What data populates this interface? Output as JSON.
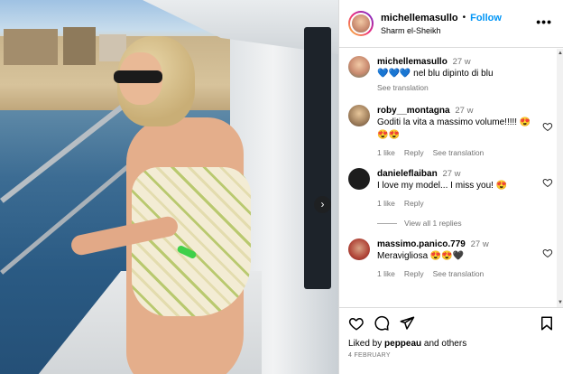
{
  "post": {
    "author": "michellemasullo",
    "follow_label": "Follow",
    "location": "Sharm el-Sheikh",
    "more_label": "•••",
    "next_label": "›"
  },
  "caption": {
    "user": "michellemasullo",
    "time": "27 w",
    "text": "💙💙💙 nel blu dipinto di blu",
    "see_translation": "See translation"
  },
  "comments": [
    {
      "user": "roby__montagna",
      "time": "27 w",
      "text": "Goditi la vita a massimo volume!!!!! 😍😍😍",
      "likes": "1 like",
      "reply": "Reply",
      "see_translation": "See translation"
    },
    {
      "user": "danieleflaiban",
      "time": "27 w",
      "text": "I love my model... I miss you! 😍",
      "likes": "1 like",
      "reply": "Reply",
      "view_replies": "View all 1 replies"
    },
    {
      "user": "massimo.panico.779",
      "time": "27 w",
      "text": "Meravigliosa 😍😍🖤",
      "likes": "1 like",
      "reply": "Reply",
      "see_translation": "See translation"
    }
  ],
  "footer": {
    "liked_by_prefix": "Liked by ",
    "liked_by_user": "peppeau",
    "liked_by_suffix": " and others",
    "date": "4 FEBRUARY"
  },
  "icons": {
    "like": "heart-icon",
    "comment": "comment-icon",
    "share": "share-icon",
    "save": "bookmark-icon"
  },
  "colors": {
    "follow": "#0095f6",
    "muted": "#737373",
    "border": "#dbdbdb"
  }
}
